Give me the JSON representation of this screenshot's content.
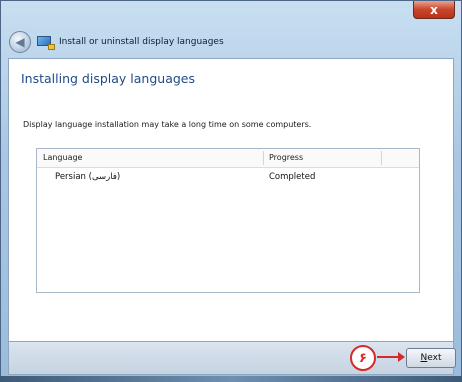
{
  "window": {
    "title": "Install or uninstall display languages",
    "close_label": "x"
  },
  "content": {
    "heading": "Installing display languages",
    "description": "Display language installation may take a long time on some computers."
  },
  "table": {
    "columns": [
      "Language",
      "Progress"
    ],
    "rows": [
      {
        "language": "Persian (فارسی)",
        "progress": "Completed"
      }
    ]
  },
  "footer": {
    "step_marker": "۶",
    "next_label_first": "N",
    "next_label_rest": "ext"
  }
}
